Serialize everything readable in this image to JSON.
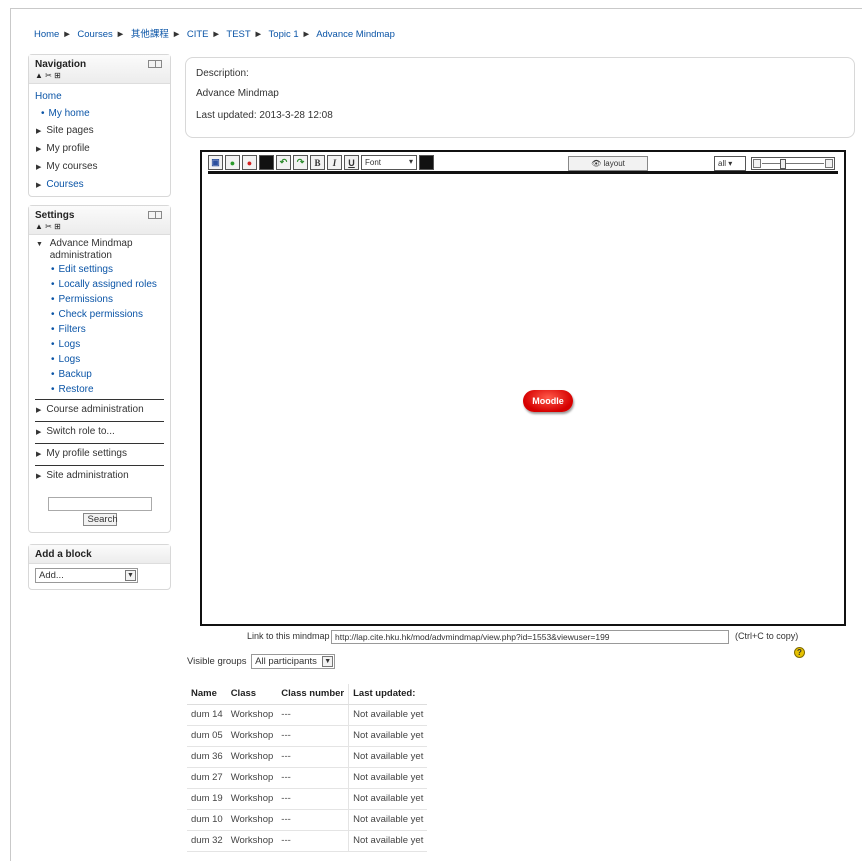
{
  "breadcrumb": {
    "items": [
      "Home",
      "Courses",
      "其他課程",
      "CITE",
      "TEST",
      "Topic 1",
      "Advance Mindmap"
    ],
    "separator": "►"
  },
  "navigation": {
    "title": "Navigation",
    "subtitle": "▲ ✂ ⊞",
    "home": "Home",
    "items": [
      {
        "label": "My home",
        "type": "link"
      },
      {
        "label": "Site pages",
        "type": "expand"
      },
      {
        "label": "My profile",
        "type": "expand"
      },
      {
        "label": "My courses",
        "type": "expand"
      },
      {
        "label": "Courses",
        "type": "expand"
      }
    ]
  },
  "settings": {
    "title": "Settings",
    "subtitle": "▲ ✂ ⊞",
    "admin_title": "Advance Mindmap administration",
    "admin_items": [
      "Edit settings",
      "Locally assigned roles",
      "Permissions",
      "Check permissions",
      "Filters",
      "Logs",
      "Logs",
      "Backup",
      "Restore"
    ],
    "sections": [
      "Course administration",
      "Switch role to...",
      "My profile settings",
      "Site administration"
    ],
    "search_button": "Search"
  },
  "add_block": {
    "title": "Add a block",
    "select_value": "Add..."
  },
  "description": {
    "label": "Description:",
    "text": "Advance Mindmap",
    "last_updated": "Last updated: 2013-3-28 12:08"
  },
  "editor": {
    "font_select": "Font",
    "layout_button": "layout",
    "zoom_select": "all",
    "root_node": "Moodle",
    "node_color": "#e00000"
  },
  "link": {
    "label": "Link to this mindmap",
    "url": "http://lap.cite.hku.hk/mod/advmindmap/view.php?id=1553&viewuser=199",
    "hint": "(Ctrl+C to copy)"
  },
  "groups": {
    "label": "Visible groups",
    "value": "All participants"
  },
  "table": {
    "headers": [
      "Name",
      "Class",
      "Class number",
      "Last updated:"
    ],
    "rows": [
      [
        "dum 14",
        "Workshop",
        "---",
        "Not available yet"
      ],
      [
        "dum 05",
        "Workshop",
        "---",
        "Not available yet"
      ],
      [
        "dum 36",
        "Workshop",
        "---",
        "Not available yet"
      ],
      [
        "dum 27",
        "Workshop",
        "---",
        "Not available yet"
      ],
      [
        "dum 19",
        "Workshop",
        "---",
        "Not available yet"
      ],
      [
        "dum 10",
        "Workshop",
        "---",
        "Not available yet"
      ],
      [
        "dum 32",
        "Workshop",
        "---",
        "Not available yet"
      ]
    ]
  }
}
